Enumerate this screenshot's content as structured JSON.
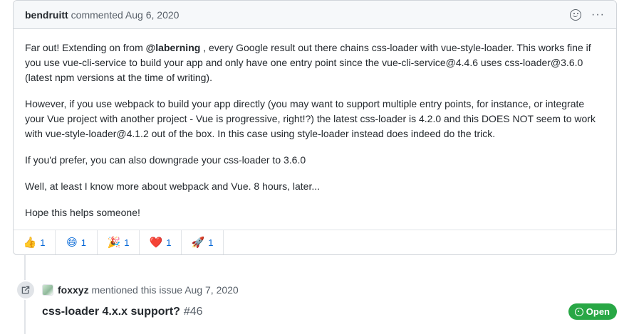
{
  "comment": {
    "author": "bendruitt",
    "action": "commented Aug 6, 2020",
    "body": {
      "p1_a": "Far out! Extending on from ",
      "p1_mention": "@laberning",
      "p1_b": " , every Google result out there chains css-loader with vue-style-loader. This works fine if you use vue-cli-service to build your app and only have one entry point since the vue-cli-service@4.4.6 uses css-loader@3.6.0 (latest npm versions at the time of writing).",
      "p2": "However, if you use webpack to build your app directly (you may want to support multiple entry points, for instance, or integrate your Vue project with another project - Vue is progressive, right!?) the latest css-loader is 4.2.0 and this DOES NOT seem to work with vue-style-loader@4.1.2 out of the box. In this case using style-loader instead does indeed do the trick.",
      "p3": "If you'd prefer, you can also downgrade your css-loader to 3.6.0",
      "p4": "Well, at least I know more about webpack and Vue. 8 hours, later...",
      "p5": "Hope this helps someone!"
    },
    "kebab_glyph": "···",
    "reactions": [
      {
        "emoji": "👍",
        "count": "1",
        "icon": "thumbs-up-icon"
      },
      {
        "emoji": "😄",
        "count": "1",
        "icon": "laugh-icon"
      },
      {
        "emoji": "🎉",
        "count": "1",
        "icon": "hooray-icon"
      },
      {
        "emoji": "❤️",
        "count": "1",
        "icon": "heart-icon"
      },
      {
        "emoji": "🚀",
        "count": "1",
        "icon": "rocket-icon"
      }
    ]
  },
  "event": {
    "user": "foxxyz",
    "text": "mentioned this issue Aug 7, 2020",
    "issue_title": "css-loader 4.x.x support?",
    "issue_number": "#46",
    "status": "Open",
    "status_color": "#28a745"
  }
}
